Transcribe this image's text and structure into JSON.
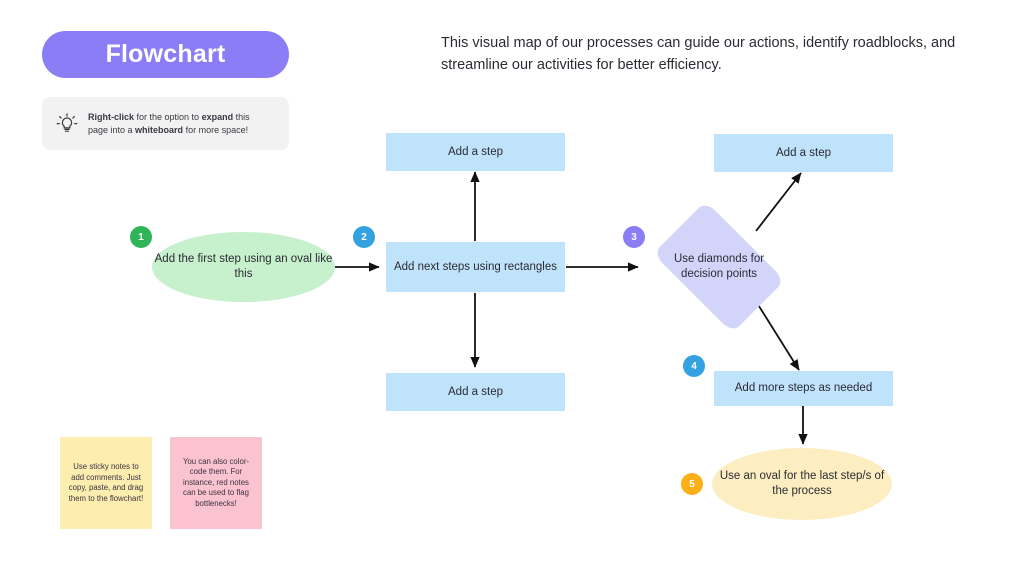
{
  "header": {
    "title": "Flowchart",
    "intro": "This visual map of our processes can guide our actions, identify roadblocks, and streamline our activities for better efficiency."
  },
  "tip": {
    "icon": "lightbulb-icon",
    "line1_bold_a": "Right-click",
    "line1_mid": " for the option to ",
    "line1_bold_b": "expand",
    "line1_end": " this",
    "line2_start": "page into a ",
    "line2_bold": "whiteboard",
    "line2_end": " for more space!"
  },
  "flow": {
    "nodes": {
      "start_oval": "Add the first step using an oval like this",
      "top_step": "Add a step",
      "center_rect": "Add next steps using rectangles",
      "bottom_step": "Add a step",
      "diamond": "Use diamonds for decision points",
      "right_top_step": "Add a step",
      "more_steps": "Add more steps as needed",
      "end_oval": "Use an oval for the last step/s of the process"
    },
    "badges": [
      {
        "number": "1",
        "color": "#2fb457"
      },
      {
        "number": "2",
        "color": "#34a2e0"
      },
      {
        "number": "3",
        "color": "#8b7df5"
      },
      {
        "number": "4",
        "color": "#34a2e0"
      },
      {
        "number": "5",
        "color": "#fdaf17"
      }
    ]
  },
  "sticky_notes": [
    {
      "color": "#fdeeb0",
      "text": "Use sticky notes to add comments. Just copy, paste, and drag them to the flowchart!"
    },
    {
      "color": "#fbc3d0",
      "text": "You can also color-code them. For instance, red notes can be used to flag bottlenecks!"
    }
  ],
  "colors": {
    "accent_purple": "#8b7df5",
    "rect_blue": "#bfe3fb",
    "oval_green": "#c7f0cd",
    "oval_yellow": "#fceec0",
    "diamond_lavender": "#d3d4fa",
    "connector": "#111111"
  }
}
